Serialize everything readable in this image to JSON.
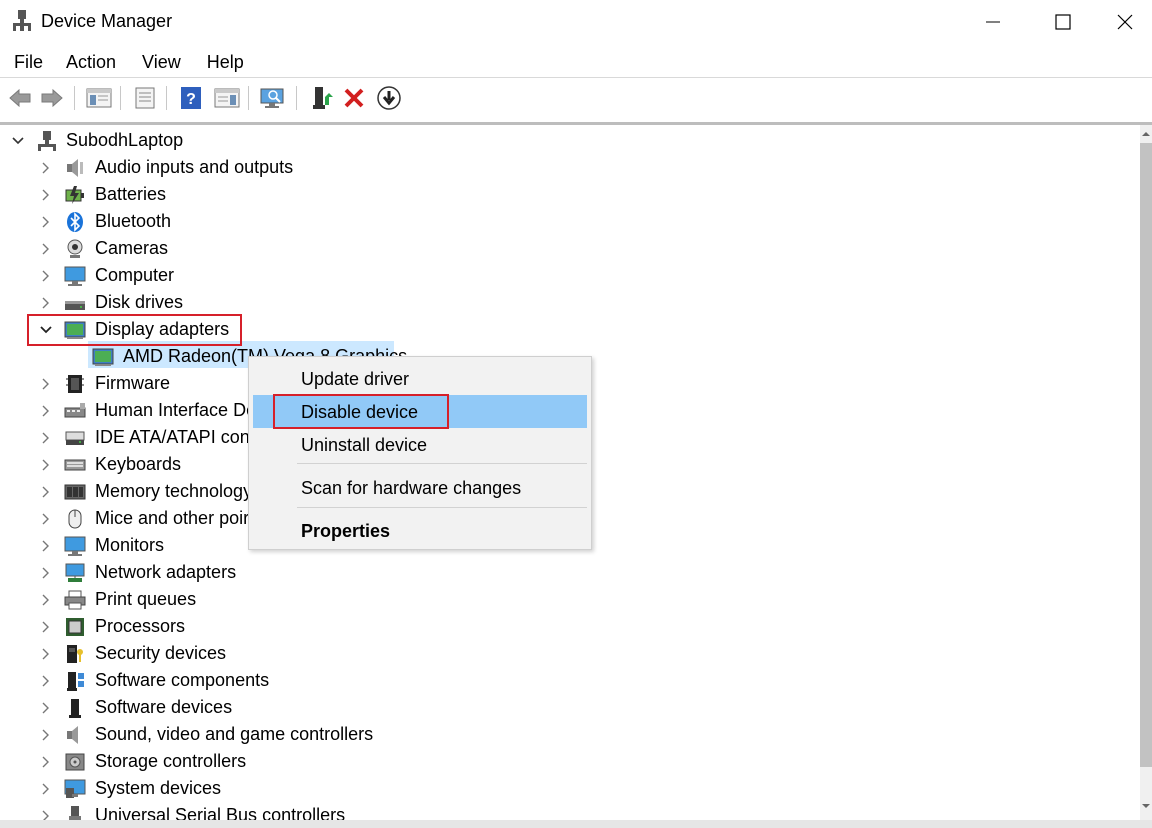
{
  "window": {
    "title": "Device Manager"
  },
  "menubar": [
    "File",
    "Action",
    "View",
    "Help"
  ],
  "toolbar": {
    "buttons": [
      "back-icon",
      "forward-icon",
      "show-hide-console-tree-icon",
      "properties-icon",
      "help-icon",
      "action-pane-icon",
      "scan-hardware-icon",
      "update-driver-icon",
      "uninstall-device-icon",
      "disable-device-icon"
    ]
  },
  "tree": {
    "root": "SubodhLaptop",
    "categories": [
      {
        "label": "Audio inputs and outputs",
        "icon": "speaker-icon"
      },
      {
        "label": "Batteries",
        "icon": "battery-icon"
      },
      {
        "label": "Bluetooth",
        "icon": "bluetooth-icon"
      },
      {
        "label": "Cameras",
        "icon": "camera-icon"
      },
      {
        "label": "Computer",
        "icon": "computer-icon"
      },
      {
        "label": "Disk drives",
        "icon": "disk-drive-icon"
      },
      {
        "label": "Display adapters",
        "icon": "display-adapter-icon",
        "expanded": true
      },
      {
        "label": "Firmware",
        "icon": "firmware-icon"
      },
      {
        "label": "Human Interface De",
        "icon": "hid-icon"
      },
      {
        "label": "IDE ATA/ATAPI contro",
        "icon": "ide-icon"
      },
      {
        "label": "Keyboards",
        "icon": "keyboard-icon"
      },
      {
        "label": "Memory technology",
        "icon": "memory-icon"
      },
      {
        "label": "Mice and other poir",
        "icon": "mouse-icon"
      },
      {
        "label": "Monitors",
        "icon": "monitor-icon"
      },
      {
        "label": "Network adapters",
        "icon": "network-adapter-icon"
      },
      {
        "label": "Print queues",
        "icon": "printer-icon"
      },
      {
        "label": "Processors",
        "icon": "processor-icon"
      },
      {
        "label": "Security devices",
        "icon": "security-device-icon"
      },
      {
        "label": "Software components",
        "icon": "software-component-icon"
      },
      {
        "label": "Software devices",
        "icon": "software-device-icon"
      },
      {
        "label": "Sound, video and game controllers",
        "icon": "sound-controller-icon"
      },
      {
        "label": "Storage controllers",
        "icon": "storage-controller-icon"
      },
      {
        "label": "System devices",
        "icon": "system-device-icon"
      },
      {
        "label": "Universal Serial Bus controllers",
        "icon": "usb-icon"
      }
    ],
    "selected_device": "AMD Radeon(TM) Vega 8 Graphics"
  },
  "context_menu": {
    "items": [
      "Update driver",
      "Disable device",
      "Uninstall device",
      "Scan for hardware changes",
      "Properties"
    ],
    "highlighted": "Disable device"
  },
  "colors": {
    "highlight_box": "#d6202a",
    "menu_hover": "#91c9f7",
    "selection": "#cce8ff"
  }
}
